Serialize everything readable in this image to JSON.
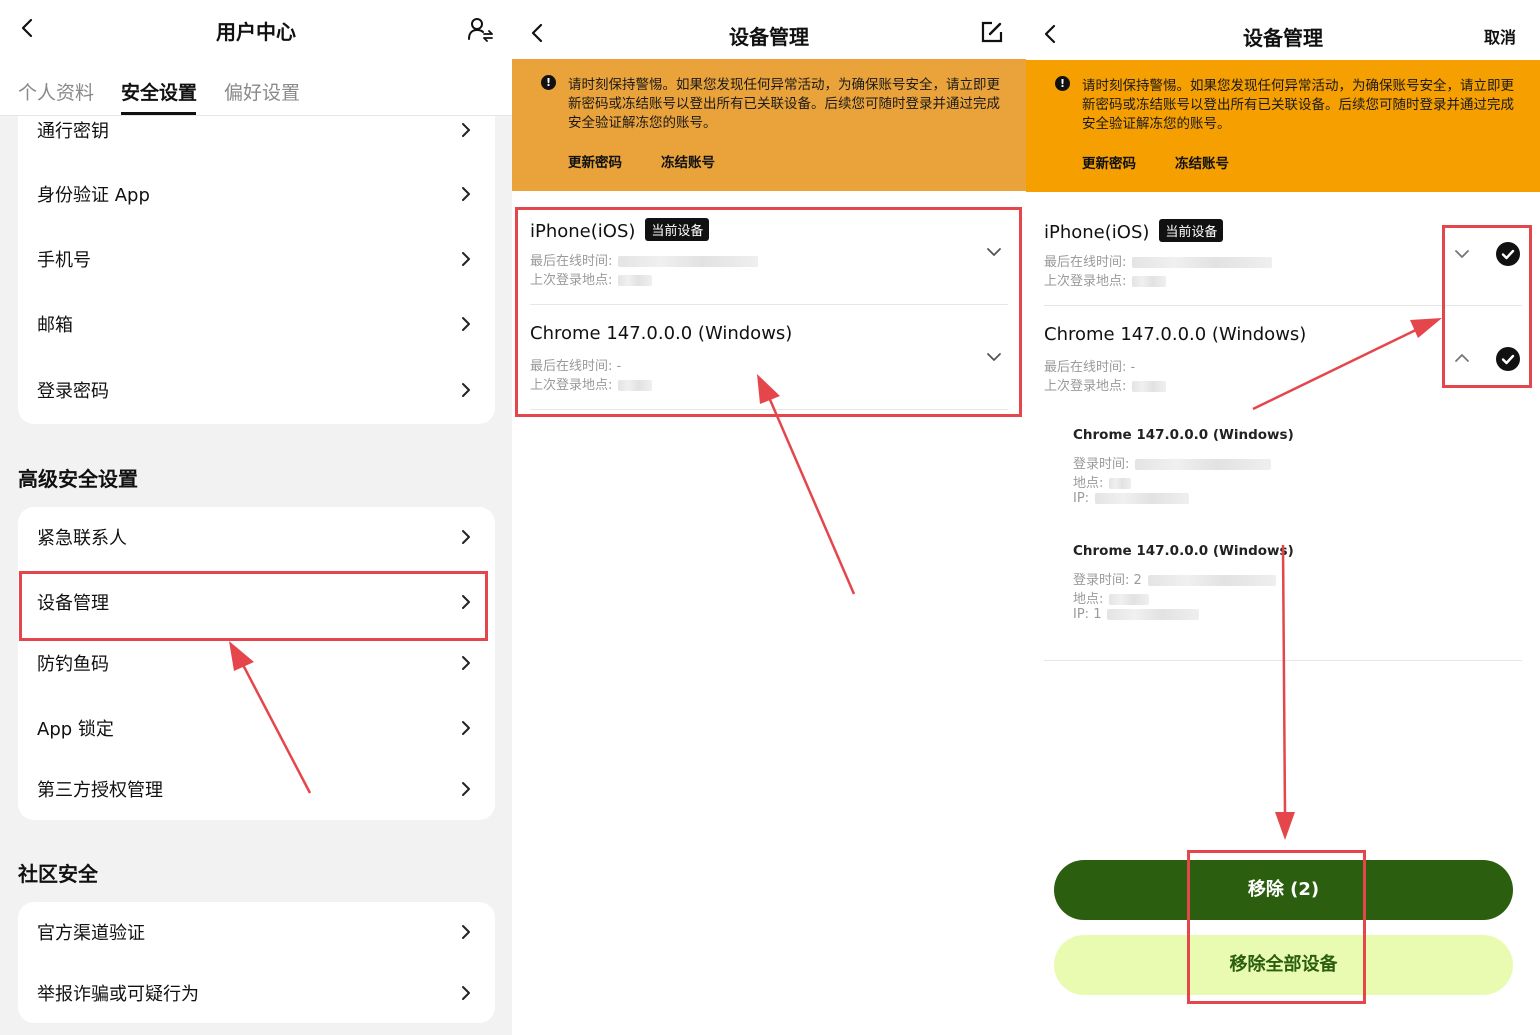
{
  "screen1": {
    "title": "用户中心",
    "tabs": [
      "个人资料",
      "安全设置",
      "偏好设置"
    ],
    "list_top": [
      "通行密钥",
      "身份验证 App",
      "手机号",
      "邮箱",
      "登录密码"
    ],
    "advanced_title": "高级安全设置",
    "advanced": [
      "紧急联系人",
      "设备管理",
      "防钓鱼码",
      "App 锁定",
      "第三方授权管理"
    ],
    "community_title": "社区安全",
    "community": [
      "官方渠道验证",
      "举报诈骗或可疑行为"
    ]
  },
  "screen2": {
    "title": "设备管理",
    "warning": "请时刻保持警惕。如果您发现任何异常活动，为确保账号安全，请立即更新密码或冻结账号以登出所有已关联设备。后续您可随时登录并通过完成安全验证解冻您的账号。",
    "update_password": "更新密码",
    "freeze_account": "冻结账号",
    "devices": [
      {
        "name": "iPhone(iOS)",
        "badge": "当前设备",
        "last_online_label": "最后在线时间:",
        "last_online": "",
        "last_location_label": "上次登录地点:"
      },
      {
        "name": "Chrome 147.0.0.0 (Windows)",
        "last_online_label": "最后在线时间:",
        "last_online": "-",
        "last_location_label": "上次登录地点:"
      }
    ]
  },
  "screen3": {
    "title": "设备管理",
    "cancel": "取消",
    "warning": "请时刻保持警惕。如果您发现任何异常活动，为确保账号安全，请立即更新密码或冻结账号以登出所有已关联设备。后续您可随时登录并通过完成安全验证解冻您的账号。",
    "update_password": "更新密码",
    "freeze_account": "冻结账号",
    "devices": [
      {
        "name": "iPhone(iOS)",
        "badge": "当前设备",
        "last_online_label": "最后在线时间:",
        "last_location_label": "上次登录地点:"
      },
      {
        "name": "Chrome 147.0.0.0 (Windows)",
        "last_online_label": "最后在线时间:",
        "last_online": "-",
        "last_location_label": "上次登录地点:"
      }
    ],
    "sessions": [
      {
        "title": "Chrome 147.0.0.0 (Windows)",
        "login_time_label": "登录时间:",
        "login_time": "",
        "location_label": "地点:",
        "ip_label": "IP:",
        "ip": ""
      },
      {
        "title": "Chrome 147.0.0.0 (Windows)",
        "login_time_label": "登录时间:",
        "login_time": "2",
        "location_label": "地点:",
        "ip_label": "IP:",
        "ip": "1"
      }
    ],
    "remove_button": "移除 (2)",
    "remove_all_button": "移除全部设备"
  },
  "colors": {
    "warning_bg_dim": "#e9a33a",
    "warning_bg": "#f59f00",
    "primary_green": "#2c5e0f",
    "light_green": "#e9fbb0",
    "annotation_red": "#e5464b"
  },
  "icons": {
    "back": "chevron-left-icon",
    "user_switch": "user-switch-icon",
    "edit": "edit-icon",
    "chevron": "chevron-right-icon",
    "expand": "chevron-down-icon",
    "collapse": "chevron-up-icon",
    "check": "check-circle-icon",
    "warning": "alert-icon"
  }
}
